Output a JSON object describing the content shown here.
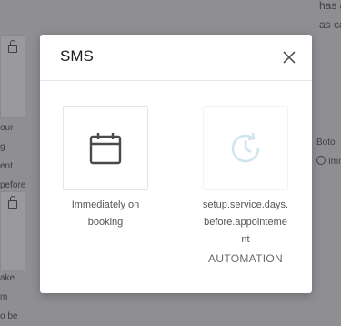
{
  "background": {
    "top_right_lines": [
      "has a",
      "as ca"
    ],
    "left_lines_1": [
      "our",
      "g",
      "ent",
      "pefore"
    ],
    "left_lines_2": [
      "ake",
      "m",
      "o be"
    ],
    "right_lines": [
      "Boto",
      "Imm"
    ]
  },
  "modal": {
    "title": "SMS",
    "options": [
      {
        "label": "Immediately on booking",
        "icon": "calendar-icon"
      },
      {
        "label": "setup.service.days.before.appointement",
        "sublabel": "AUTOMATION",
        "icon": "clock-refresh-icon"
      }
    ]
  },
  "colors": {
    "overlay": "#8f8f93",
    "modal_bg": "#ffffff",
    "icon_dark": "#4a4a4a",
    "icon_faded": "#cfe6f0"
  }
}
